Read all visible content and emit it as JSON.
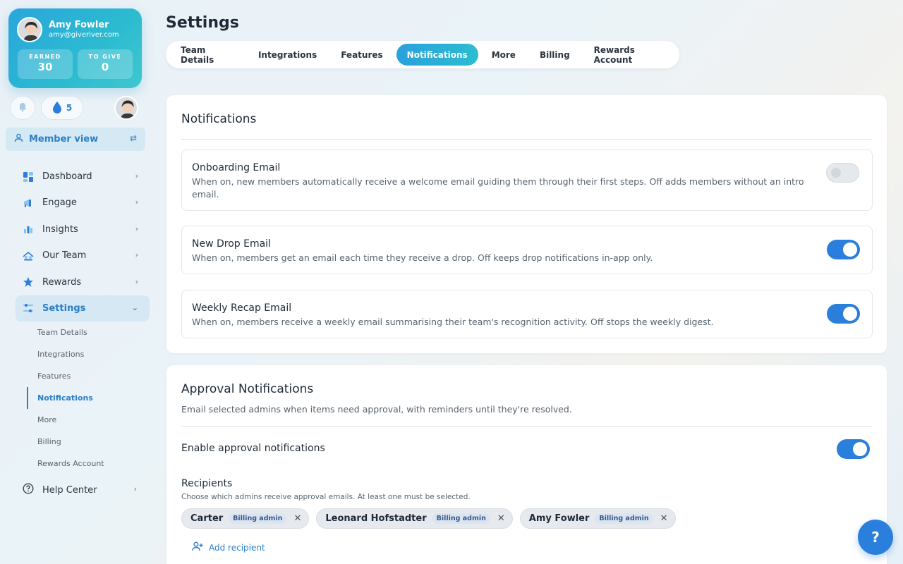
{
  "profile": {
    "name": "Amy Fowler",
    "email": "amy@giveriver.com",
    "earned_label": "EARNED",
    "earned_value": "30",
    "give_label": "TO GIVE",
    "give_value": "0"
  },
  "drops": {
    "count": "5"
  },
  "member_view": {
    "label": "Member view"
  },
  "nav": {
    "items": [
      {
        "label": "Dashboard",
        "icon": "dashboard-icon"
      },
      {
        "label": "Engage",
        "icon": "megaphone-icon"
      },
      {
        "label": "Insights",
        "icon": "bar-chart-icon"
      },
      {
        "label": "Our Team",
        "icon": "team-icon"
      },
      {
        "label": "Rewards",
        "icon": "star-icon"
      },
      {
        "label": "Settings",
        "icon": "settings-sliders-icon"
      }
    ],
    "sub_items": [
      "Team Details",
      "Integrations",
      "Features",
      "Notifications",
      "More",
      "Billing",
      "Rewards Account"
    ],
    "help_label": "Help Center"
  },
  "page": {
    "title": "Settings"
  },
  "tabs": [
    "Team Details",
    "Integrations",
    "Features",
    "Notifications",
    "More",
    "Billing",
    "Rewards Account"
  ],
  "notifications": {
    "title": "Notifications",
    "rows": [
      {
        "title": "Onboarding Email",
        "desc": "When on, new members automatically receive a welcome email guiding them through their first steps. Off adds members without an intro email.",
        "enabled": false
      },
      {
        "title": "New Drop Email",
        "desc": "When on, members get an email each time they receive a drop. Off keeps drop notifications in-app only.",
        "enabled": true
      },
      {
        "title": "Weekly Recap Email",
        "desc": "When on, members receive a weekly email summarising their team's recognition activity. Off stops the weekly digest.",
        "enabled": true
      }
    ]
  },
  "approval": {
    "title": "Approval Notifications",
    "desc": "Email selected admins when items need approval, with reminders until they're resolved.",
    "enable_label": "Enable approval notifications",
    "enabled": true,
    "recipients_title": "Recipients",
    "recipients_hint": "Choose which admins receive approval emails. At least one must be selected.",
    "recipients": [
      {
        "name": "Carter",
        "role": "Billing admin"
      },
      {
        "name": "Leonard Hofstadter",
        "role": "Billing admin"
      },
      {
        "name": "Amy Fowler",
        "role": "Billing admin"
      }
    ],
    "add_label": "Add recipient"
  },
  "help_fab": {
    "label": "?"
  },
  "colors": {
    "accent": "#2a7fdc",
    "teal": "#2bbdd0"
  }
}
